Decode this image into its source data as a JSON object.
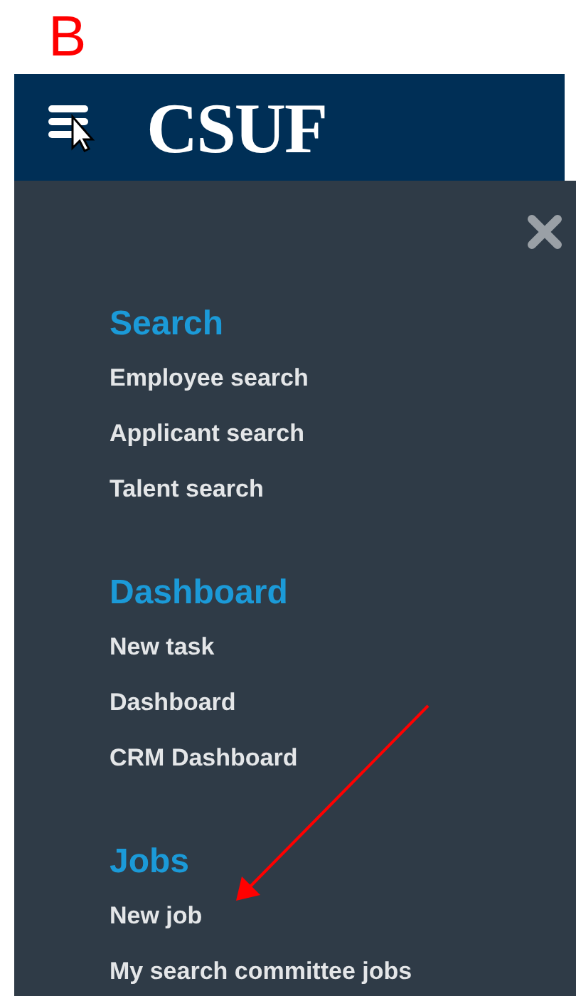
{
  "annotation": {
    "label": "B"
  },
  "header": {
    "logo": "CSUF"
  },
  "menu": {
    "sections": [
      {
        "heading": "Search",
        "items": [
          "Employee search",
          "Applicant search",
          "Talent search"
        ]
      },
      {
        "heading": "Dashboard",
        "items": [
          "New task",
          "Dashboard",
          "CRM Dashboard"
        ]
      },
      {
        "heading": "Jobs",
        "items": [
          "New job",
          "My search committee jobs"
        ]
      }
    ]
  }
}
